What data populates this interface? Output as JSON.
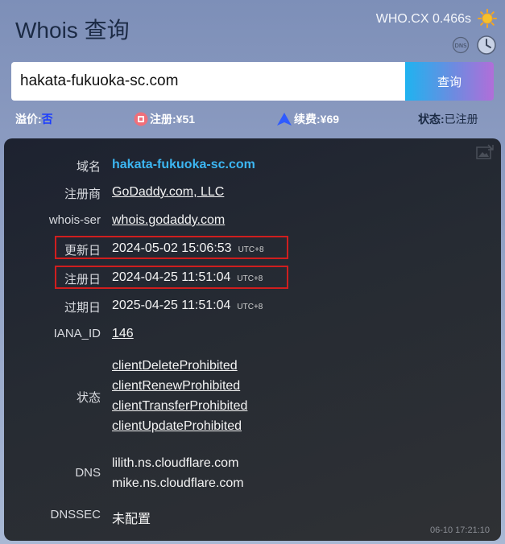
{
  "header": {
    "title": "Whois 查询",
    "speed": "WHO.CX 0.466s",
    "icons": {
      "theme": "sun-icon",
      "dns": "dns-icon",
      "history": "clock-icon"
    }
  },
  "search": {
    "value": "hakata-fukuoka-sc.com",
    "placeholder": "",
    "button_label": "查询"
  },
  "summary": {
    "premium_label": "溢价:",
    "premium_value": "否",
    "register_label": "注册:",
    "register_value": "¥51",
    "renew_label": "续费:",
    "renew_value": "¥69",
    "status_label": "状态:",
    "status_value": "已注册"
  },
  "whois": {
    "domain_label": "域名",
    "domain_value": "hakata-fukuoka-sc.com",
    "registrar_label": "注册商",
    "registrar_value": "GoDaddy.com, LLC",
    "whois_server_label": "whois-ser",
    "whois_server_value": "whois.godaddy.com",
    "updated_label": "更新日",
    "updated_value": "2024-05-02 15:06:53",
    "created_label": "注册日",
    "created_value": "2024-04-25 11:51:04",
    "expires_label": "过期日",
    "expires_value": "2025-04-25 11:51:04",
    "tz": "UTC+8",
    "iana_label": "IANA_ID",
    "iana_value": "146",
    "status_label": "状态",
    "statuses": [
      "clientDeleteProhibited",
      "clientRenewProhibited",
      "clientTransferProhibited",
      "clientUpdateProhibited"
    ],
    "dns_label": "DNS",
    "nameservers": [
      "lilith.ns.cloudflare.com",
      "mike.ns.cloudflare.com"
    ],
    "dnssec_label": "DNSSEC",
    "dnssec_value": "未配置"
  },
  "footer": {
    "timestamp": "06-10 17:21:10"
  },
  "colors": {
    "accent_link": "#3cb6f2",
    "highlight_border": "#d01e1e",
    "premium_value": "#1a3cff",
    "search_gradient_start": "#1fb3f0",
    "search_gradient_end": "#b16ed9"
  }
}
